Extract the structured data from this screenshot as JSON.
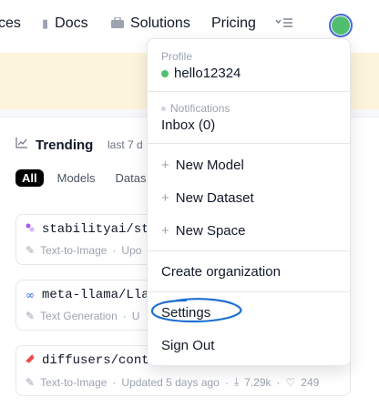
{
  "nav": {
    "items": [
      {
        "label": "ces",
        "icon": "spaces-icon"
      },
      {
        "label": "Docs",
        "icon": "docs-icon"
      },
      {
        "label": "Solutions",
        "icon": "briefcase-icon"
      },
      {
        "label": "Pricing",
        "icon": ""
      }
    ],
    "menu_icon": "menu-icon",
    "avatar_color": "#4fbf6f"
  },
  "trending": {
    "title": "Trending",
    "subtitle": "last 7 d",
    "tabs": [
      "All",
      "Models",
      "Dataset"
    ]
  },
  "cards": [
    {
      "icon_color": "#a855f7",
      "title": "stabilityai/st",
      "type": "Text-to-Image",
      "updated": "Upo"
    },
    {
      "icon_color": "#2563eb",
      "title": "meta-llama/Lla",
      "type": "Text Generation",
      "updated": "U"
    },
    {
      "icon_color": "#ef4444",
      "title": "diffusers/cont",
      "type": "Text-to-Image",
      "updated": "Updated 5 days ago",
      "downloads": "7.29k",
      "likes": "249"
    }
  ],
  "dropdown": {
    "profile_label": "Profile",
    "username": "hello12324",
    "status_color": "#4fbf6f",
    "notifications_label": "Notifications",
    "inbox": "Inbox (0)",
    "new_model": "New Model",
    "new_dataset": "New Dataset",
    "new_space": "New Space",
    "create_org": "Create organization",
    "settings": "Settings",
    "sign_out": "Sign Out"
  },
  "annotation_color": "#1f6fd1"
}
